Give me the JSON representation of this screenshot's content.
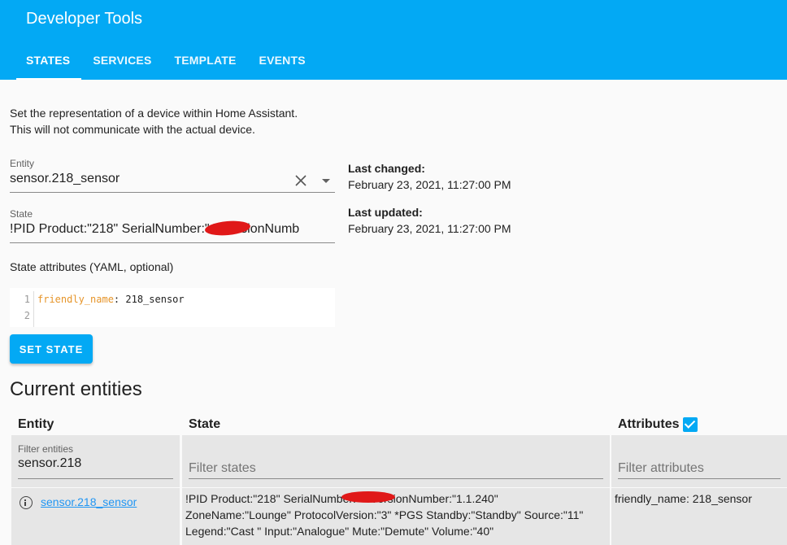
{
  "header": {
    "title": "Developer Tools",
    "tabs": [
      {
        "label": "STATES",
        "active": true
      },
      {
        "label": "SERVICES",
        "active": false
      },
      {
        "label": "TEMPLATE",
        "active": false
      },
      {
        "label": "EVENTS",
        "active": false
      }
    ]
  },
  "description": {
    "line1": "Set the representation of a device within Home Assistant.",
    "line2": "This will not communicate with the actual device."
  },
  "entity_field": {
    "label": "Entity",
    "value": "sensor.218_sensor",
    "clear_icon": "close-icon",
    "dropdown_icon": "chevron-down-icon"
  },
  "state_field": {
    "label": "State",
    "value": "!PID Product:\"218\" SerialNumber:\"           \" VersionNumb"
  },
  "last_changed": {
    "label": "Last changed:",
    "value": "February 23, 2021, 11:27:00 PM"
  },
  "last_updated": {
    "label": "Last updated:",
    "value": "February 23, 2021, 11:27:00 PM"
  },
  "attributes_editor": {
    "label": "State attributes (YAML, optional)",
    "line_numbers": [
      "1",
      "2"
    ],
    "key": "friendly_name",
    "separator": ": ",
    "value": "218_sensor"
  },
  "set_state_button": "SET STATE",
  "current_entities": {
    "title": "Current entities",
    "columns": {
      "entity": "Entity",
      "state": "State",
      "attributes": "Attributes"
    },
    "attributes_checked": true,
    "filters": {
      "entity_label": "Filter entities",
      "entity_value": "sensor.218",
      "state_placeholder": "Filter states",
      "attributes_placeholder": "Filter attributes"
    },
    "rows": [
      {
        "entity": "sensor.218_sensor",
        "state_lines": [
          "!PID Product:\"218\" SerialNumber:\"             \" VersionNumber:\"1.1.240\"",
          "ZoneName:\"Lounge\" ProtocolVersion:\"3\" *PGS Standby:\"Standby\" Source:\"11\"",
          "Legend:\"Cast \" Input:\"Analogue\" Mute:\"Demute\" Volume:\"40\""
        ],
        "attributes": "friendly_name: 218_sensor"
      }
    ]
  },
  "colors": {
    "primary": "#03a9f4",
    "link": "#2196f3",
    "redaction": "#e01818",
    "yaml_key": "#e6952a"
  }
}
